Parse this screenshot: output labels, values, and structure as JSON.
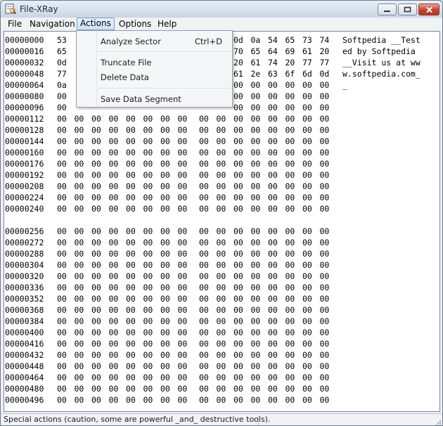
{
  "window": {
    "title": "File-XRay"
  },
  "menu": {
    "items": [
      "File",
      "Navigation",
      "Actions",
      "Options",
      "Help"
    ],
    "active": "Actions"
  },
  "hex": {
    "rows_top": [
      {
        "offset": "00000000",
        "bytes": [
          "53",
          "",
          "",
          "",
          "",
          "",
          "",
          "",
          "",
          "",
          "0d",
          "0a",
          "54",
          "65",
          "73",
          "74"
        ]
      },
      {
        "offset": "00000016",
        "bytes": [
          "65",
          "",
          "",
          "",
          "",
          "",
          "",
          "",
          "",
          "",
          "70",
          "65",
          "64",
          "69",
          "61",
          "20"
        ]
      },
      {
        "offset": "00000032",
        "bytes": [
          "0d",
          "",
          "",
          "",
          "",
          "",
          "",
          "",
          "",
          "",
          "20",
          "61",
          "74",
          "20",
          "77",
          "77"
        ]
      },
      {
        "offset": "00000048",
        "bytes": [
          "77",
          "",
          "",
          "",
          "",
          "",
          "",
          "",
          "",
          "",
          "61",
          "2e",
          "63",
          "6f",
          "6d",
          "0d"
        ]
      },
      {
        "offset": "00000064",
        "bytes": [
          "0a",
          "",
          "",
          "",
          "",
          "",
          "",
          "",
          "",
          "",
          "00",
          "00",
          "00",
          "00",
          "00",
          "00"
        ]
      },
      {
        "offset": "00000080",
        "bytes": [
          "00",
          "",
          "",
          "",
          "",
          "",
          "",
          "",
          "",
          "",
          "00",
          "00",
          "00",
          "00",
          "00",
          "00"
        ]
      },
      {
        "offset": "00000096",
        "bytes": [
          "00",
          "",
          "",
          "",
          "",
          "",
          "",
          "",
          "",
          "",
          "00",
          "00",
          "00",
          "00",
          "00",
          "00"
        ]
      },
      {
        "offset": "00000112",
        "bytes": [
          "00",
          "00",
          "00",
          "00",
          "00",
          "00",
          "00",
          "00",
          "00",
          "00",
          "00",
          "00",
          "00",
          "00",
          "00",
          "00"
        ]
      },
      {
        "offset": "00000128",
        "bytes": [
          "00",
          "00",
          "00",
          "00",
          "00",
          "00",
          "00",
          "00",
          "00",
          "00",
          "00",
          "00",
          "00",
          "00",
          "00",
          "00"
        ]
      },
      {
        "offset": "00000144",
        "bytes": [
          "00",
          "00",
          "00",
          "00",
          "00",
          "00",
          "00",
          "00",
          "00",
          "00",
          "00",
          "00",
          "00",
          "00",
          "00",
          "00"
        ]
      },
      {
        "offset": "00000160",
        "bytes": [
          "00",
          "00",
          "00",
          "00",
          "00",
          "00",
          "00",
          "00",
          "00",
          "00",
          "00",
          "00",
          "00",
          "00",
          "00",
          "00"
        ]
      },
      {
        "offset": "00000176",
        "bytes": [
          "00",
          "00",
          "00",
          "00",
          "00",
          "00",
          "00",
          "00",
          "00",
          "00",
          "00",
          "00",
          "00",
          "00",
          "00",
          "00"
        ]
      },
      {
        "offset": "00000192",
        "bytes": [
          "00",
          "00",
          "00",
          "00",
          "00",
          "00",
          "00",
          "00",
          "00",
          "00",
          "00",
          "00",
          "00",
          "00",
          "00",
          "00"
        ]
      },
      {
        "offset": "00000208",
        "bytes": [
          "00",
          "00",
          "00",
          "00",
          "00",
          "00",
          "00",
          "00",
          "00",
          "00",
          "00",
          "00",
          "00",
          "00",
          "00",
          "00"
        ]
      },
      {
        "offset": "00000224",
        "bytes": [
          "00",
          "00",
          "00",
          "00",
          "00",
          "00",
          "00",
          "00",
          "00",
          "00",
          "00",
          "00",
          "00",
          "00",
          "00",
          "00"
        ]
      },
      {
        "offset": "00000240",
        "bytes": [
          "00",
          "00",
          "00",
          "00",
          "00",
          "00",
          "00",
          "00",
          "00",
          "00",
          "00",
          "00",
          "00",
          "00",
          "00",
          "00"
        ]
      }
    ],
    "rows_bottom": [
      {
        "offset": "00000256",
        "bytes": [
          "00",
          "00",
          "00",
          "00",
          "00",
          "00",
          "00",
          "00",
          "00",
          "00",
          "00",
          "00",
          "00",
          "00",
          "00",
          "00"
        ]
      },
      {
        "offset": "00000272",
        "bytes": [
          "00",
          "00",
          "00",
          "00",
          "00",
          "00",
          "00",
          "00",
          "00",
          "00",
          "00",
          "00",
          "00",
          "00",
          "00",
          "00"
        ]
      },
      {
        "offset": "00000288",
        "bytes": [
          "00",
          "00",
          "00",
          "00",
          "00",
          "00",
          "00",
          "00",
          "00",
          "00",
          "00",
          "00",
          "00",
          "00",
          "00",
          "00"
        ]
      },
      {
        "offset": "00000304",
        "bytes": [
          "00",
          "00",
          "00",
          "00",
          "00",
          "00",
          "00",
          "00",
          "00",
          "00",
          "00",
          "00",
          "00",
          "00",
          "00",
          "00"
        ]
      },
      {
        "offset": "00000320",
        "bytes": [
          "00",
          "00",
          "00",
          "00",
          "00",
          "00",
          "00",
          "00",
          "00",
          "00",
          "00",
          "00",
          "00",
          "00",
          "00",
          "00"
        ]
      },
      {
        "offset": "00000336",
        "bytes": [
          "00",
          "00",
          "00",
          "00",
          "00",
          "00",
          "00",
          "00",
          "00",
          "00",
          "00",
          "00",
          "00",
          "00",
          "00",
          "00"
        ]
      },
      {
        "offset": "00000352",
        "bytes": [
          "00",
          "00",
          "00",
          "00",
          "00",
          "00",
          "00",
          "00",
          "00",
          "00",
          "00",
          "00",
          "00",
          "00",
          "00",
          "00"
        ]
      },
      {
        "offset": "00000368",
        "bytes": [
          "00",
          "00",
          "00",
          "00",
          "00",
          "00",
          "00",
          "00",
          "00",
          "00",
          "00",
          "00",
          "00",
          "00",
          "00",
          "00"
        ]
      },
      {
        "offset": "00000384",
        "bytes": [
          "00",
          "00",
          "00",
          "00",
          "00",
          "00",
          "00",
          "00",
          "00",
          "00",
          "00",
          "00",
          "00",
          "00",
          "00",
          "00"
        ]
      },
      {
        "offset": "00000400",
        "bytes": [
          "00",
          "00",
          "00",
          "00",
          "00",
          "00",
          "00",
          "00",
          "00",
          "00",
          "00",
          "00",
          "00",
          "00",
          "00",
          "00"
        ]
      },
      {
        "offset": "00000416",
        "bytes": [
          "00",
          "00",
          "00",
          "00",
          "00",
          "00",
          "00",
          "00",
          "00",
          "00",
          "00",
          "00",
          "00",
          "00",
          "00",
          "00"
        ]
      },
      {
        "offset": "00000432",
        "bytes": [
          "00",
          "00",
          "00",
          "00",
          "00",
          "00",
          "00",
          "00",
          "00",
          "00",
          "00",
          "00",
          "00",
          "00",
          "00",
          "00"
        ]
      },
      {
        "offset": "00000448",
        "bytes": [
          "00",
          "00",
          "00",
          "00",
          "00",
          "00",
          "00",
          "00",
          "00",
          "00",
          "00",
          "00",
          "00",
          "00",
          "00",
          "00"
        ]
      },
      {
        "offset": "00000464",
        "bytes": [
          "00",
          "00",
          "00",
          "00",
          "00",
          "00",
          "00",
          "00",
          "00",
          "00",
          "00",
          "00",
          "00",
          "00",
          "00",
          "00"
        ]
      },
      {
        "offset": "00000480",
        "bytes": [
          "00",
          "00",
          "00",
          "00",
          "00",
          "00",
          "00",
          "00",
          "00",
          "00",
          "00",
          "00",
          "00",
          "00",
          "00",
          "00"
        ]
      },
      {
        "offset": "00000496",
        "bytes": [
          "00",
          "00",
          "00",
          "00",
          "00",
          "00",
          "00",
          "00",
          "00",
          "00",
          "00",
          "00",
          "00",
          "00",
          "00",
          "00"
        ]
      }
    ],
    "ascii_lines": [
      "Softpedia __Test",
      "ed by Softpedia ",
      "__Visit us at ww",
      "w.softpedia.com_",
      "_"
    ]
  },
  "actions_menu": {
    "items": [
      {
        "label": "Analyze Sector",
        "shortcut": "Ctrl+D"
      },
      {
        "label": "Truncate File",
        "shortcut": ""
      },
      {
        "label": "Delete Data",
        "shortcut": ""
      },
      {
        "label": "Save Data Segment",
        "shortcut": ""
      }
    ]
  },
  "status": {
    "text": "Special actions (caution, some are powerful _and_ destructive tools)."
  },
  "icons": {
    "app": "xray-app-icon",
    "minimize": "minimize-icon",
    "maximize": "maximize-icon",
    "close": "close-icon",
    "grip": "resize-grip-icon"
  }
}
